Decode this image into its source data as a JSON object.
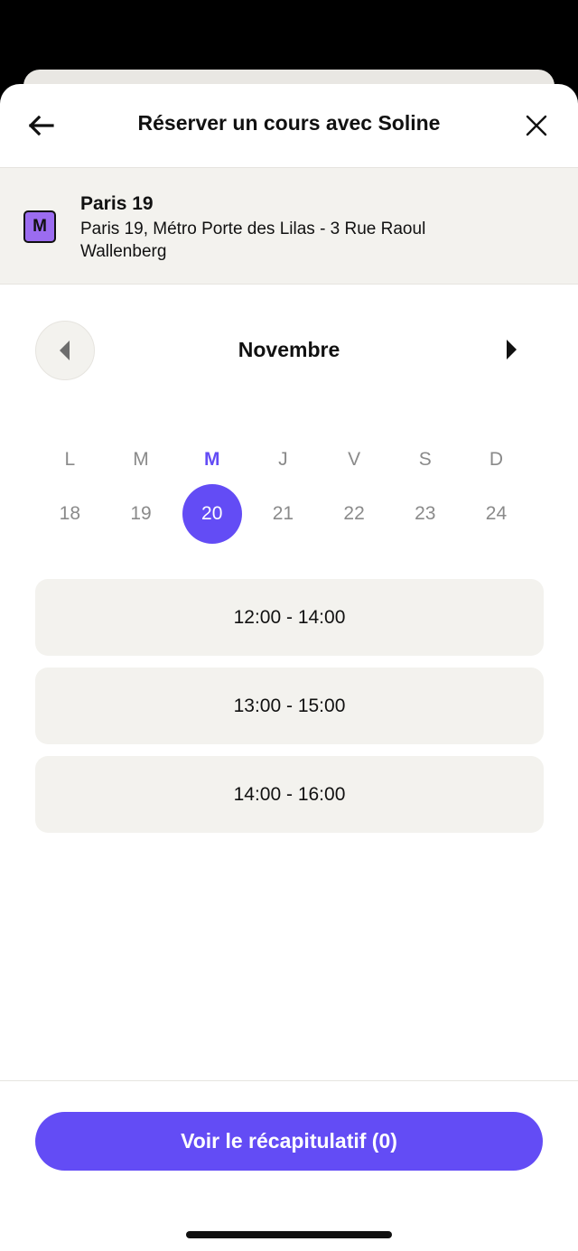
{
  "header": {
    "title": "Réserver un cours avec Soline"
  },
  "location": {
    "badge": "M",
    "name": "Paris 19",
    "address": "Paris 19, Métro Porte des Lilas - 3 Rue Raoul Wallenberg"
  },
  "calendar": {
    "month": "Novembre",
    "weekdays": [
      "L",
      "M",
      "M",
      "J",
      "V",
      "S",
      "D"
    ],
    "dates": [
      "18",
      "19",
      "20",
      "21",
      "22",
      "23",
      "24"
    ],
    "selected_index": 2
  },
  "slots": [
    "12:00 - 14:00",
    "13:00 - 15:00",
    "14:00 - 16:00"
  ],
  "cta": {
    "label": "Voir le récapitulatif (0)"
  },
  "colors": {
    "accent": "#634cf5",
    "surface": "#f3f2ee",
    "metro_badge": "#9b6cf0"
  }
}
